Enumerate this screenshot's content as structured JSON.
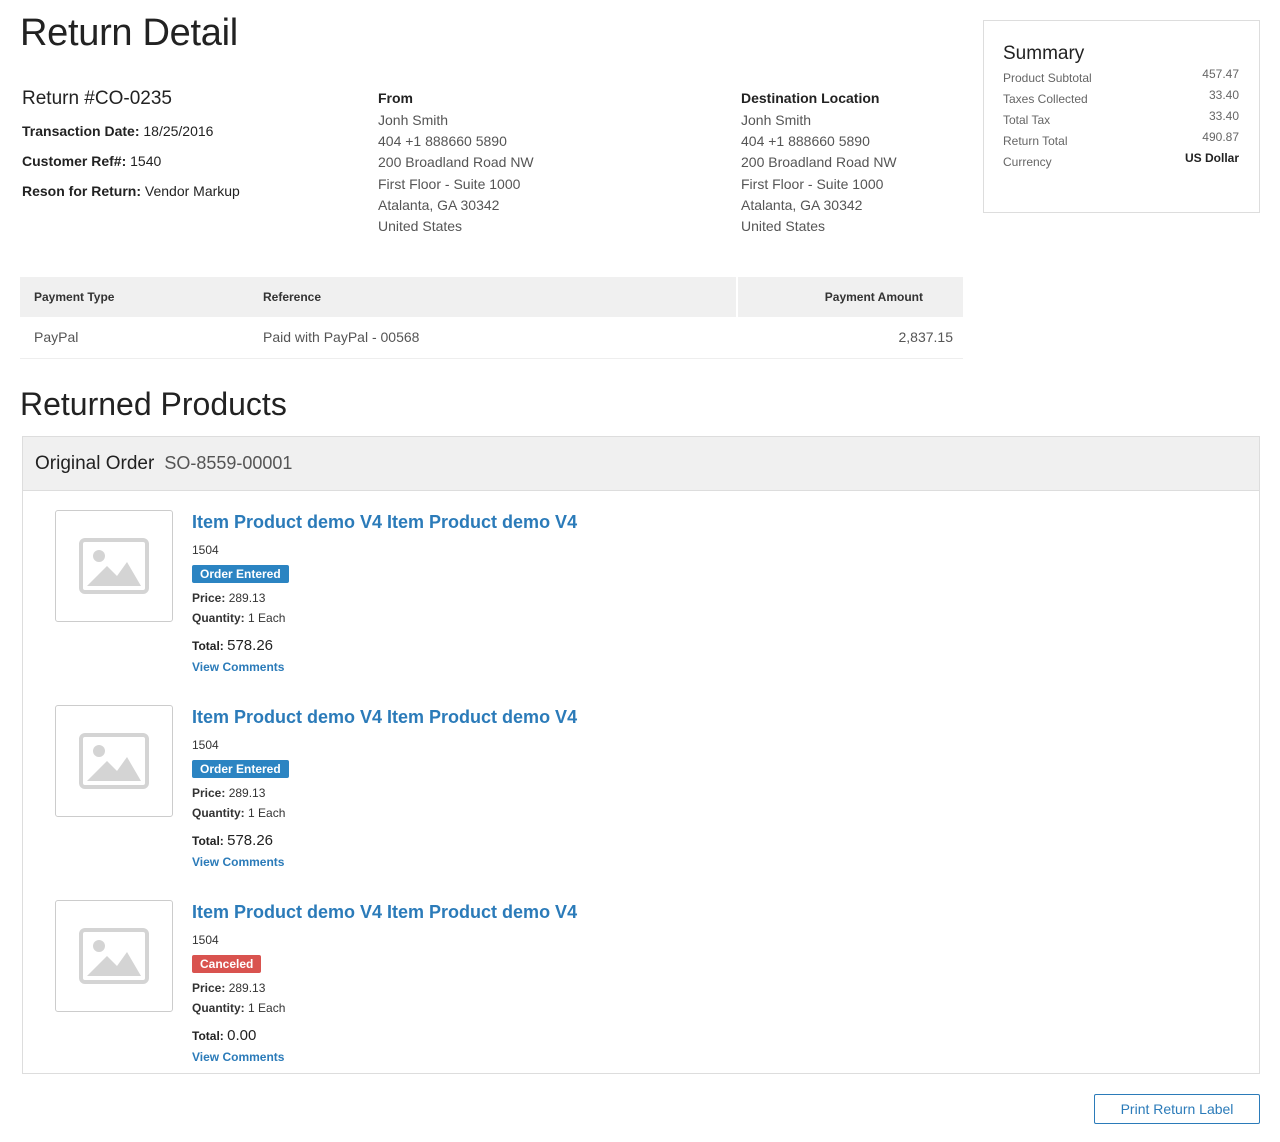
{
  "page": {
    "title": "Return Detail"
  },
  "return": {
    "number": "Return #CO-0235",
    "transaction_date_label": "Transaction Date:",
    "transaction_date": "18/25/2016",
    "customer_ref_label": "Customer Ref#:",
    "customer_ref": "1540",
    "reason_label": "Reson for Return:",
    "reason": "Vendor Markup"
  },
  "from": {
    "title": "From",
    "lines": [
      "Jonh Smith",
      "404 +1 888660 5890",
      "200 Broadland Road NW",
      "First Floor - Suite 1000",
      "Atalanta, GA 30342",
      "United States"
    ]
  },
  "destination": {
    "title": "Destination Location",
    "lines": [
      "Jonh Smith",
      "404 +1 888660 5890",
      "200 Broadland Road NW",
      "First Floor - Suite 1000",
      "Atalanta, GA 30342",
      "United States"
    ]
  },
  "summary": {
    "title": "Summary",
    "rows": [
      {
        "label": "Product Subtotal",
        "value": "457.47"
      },
      {
        "label": "Taxes Collected",
        "value": "33.40"
      },
      {
        "label": "Total Tax",
        "value": "33.40"
      },
      {
        "label": "Return Total",
        "value": "490.87"
      },
      {
        "label": "Currency",
        "value": "US Dollar"
      }
    ]
  },
  "payment": {
    "headers": {
      "type": "Payment Type",
      "reference": "Reference",
      "amount": "Payment Amount"
    },
    "rows": [
      {
        "type": "PayPal",
        "reference": "Paid with PayPal - 00568",
        "amount": "2,837.15"
      }
    ]
  },
  "returned_products": {
    "title": "Returned Products",
    "order_label": "Original Order",
    "order_number": "SO-8559-00001",
    "price_label": "Price:",
    "quantity_label": "Quantity:",
    "total_label": "Total:",
    "view_comments": "View Comments",
    "items": [
      {
        "name": "Item Product demo V4 Item Product demo V4",
        "sku": "1504",
        "status": "Order Entered",
        "price": "289.13",
        "quantity": "1 Each",
        "total": "578.26"
      },
      {
        "name": "Item Product demo V4 Item Product demo V4",
        "sku": "1504",
        "status": "Order Entered",
        "price": "289.13",
        "quantity": "1 Each",
        "total": "578.26"
      },
      {
        "name": "Item Product demo V4 Item Product demo V4",
        "sku": "1504",
        "status": "Canceled",
        "price": "289.13",
        "quantity": "1 Each",
        "total": "0.00"
      }
    ]
  },
  "actions": {
    "print_label": "Print Return Label"
  },
  "colors": {
    "link": "#2b7bb9",
    "badge_entered": "#2b84c2",
    "badge_canceled": "#d9534f"
  }
}
